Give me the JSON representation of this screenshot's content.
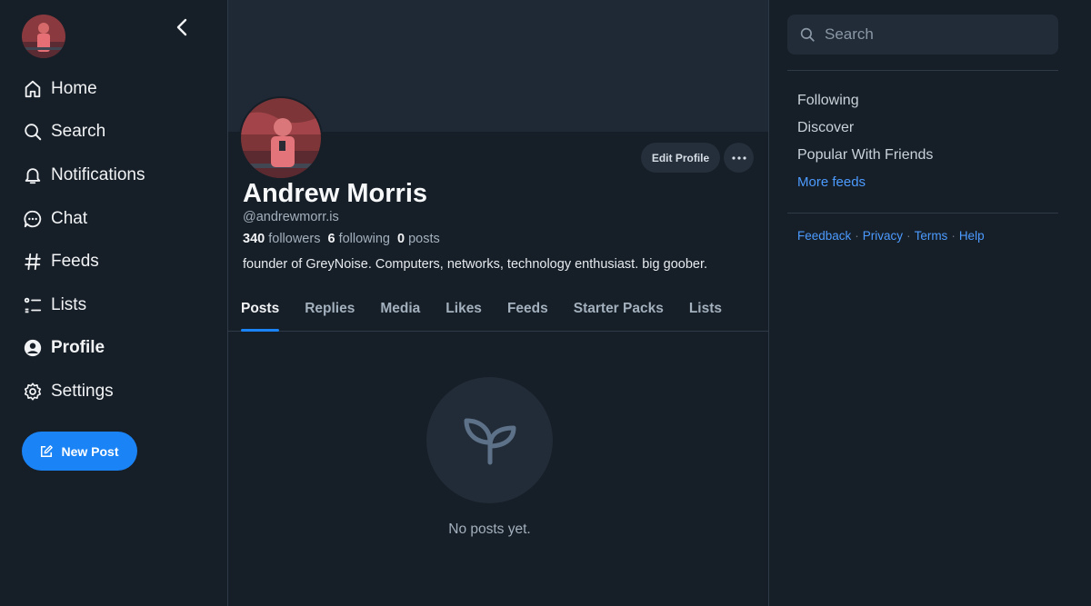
{
  "sidebar": {
    "nav": [
      {
        "label": "Home",
        "icon": "home-icon"
      },
      {
        "label": "Search",
        "icon": "search-icon"
      },
      {
        "label": "Notifications",
        "icon": "bell-icon"
      },
      {
        "label": "Chat",
        "icon": "chat-icon"
      },
      {
        "label": "Feeds",
        "icon": "hash-icon"
      },
      {
        "label": "Lists",
        "icon": "list-icon"
      },
      {
        "label": "Profile",
        "icon": "user-circle-icon",
        "active": true
      },
      {
        "label": "Settings",
        "icon": "gear-icon"
      }
    ],
    "new_post_label": "New Post"
  },
  "profile": {
    "display_name": "Andrew Morris",
    "handle": "@andrewmorr.is",
    "followers_count": "340",
    "followers_label": "followers",
    "following_count": "6",
    "following_label": "following",
    "posts_count": "0",
    "posts_label": "posts",
    "bio": "founder of GreyNoise. Computers, networks, technology enthusiast. big goober.",
    "edit_label": "Edit Profile"
  },
  "tabs": [
    "Posts",
    "Replies",
    "Media",
    "Likes",
    "Feeds",
    "Starter Packs",
    "Lists"
  ],
  "active_tab": "Posts",
  "empty_state": {
    "text": "No posts yet.",
    "icon": "seedling-icon"
  },
  "right": {
    "search_placeholder": "Search",
    "feeds": [
      "Following",
      "Discover",
      "Popular With Friends"
    ],
    "more_feeds": "More feeds",
    "footer": [
      "Feedback",
      "Privacy",
      "Terms",
      "Help"
    ]
  },
  "colors": {
    "background": "#161e27",
    "accent": "#1a83f5",
    "link": "#4c9bff",
    "muted": "#a3b0bd",
    "border": "#2e3a47"
  }
}
